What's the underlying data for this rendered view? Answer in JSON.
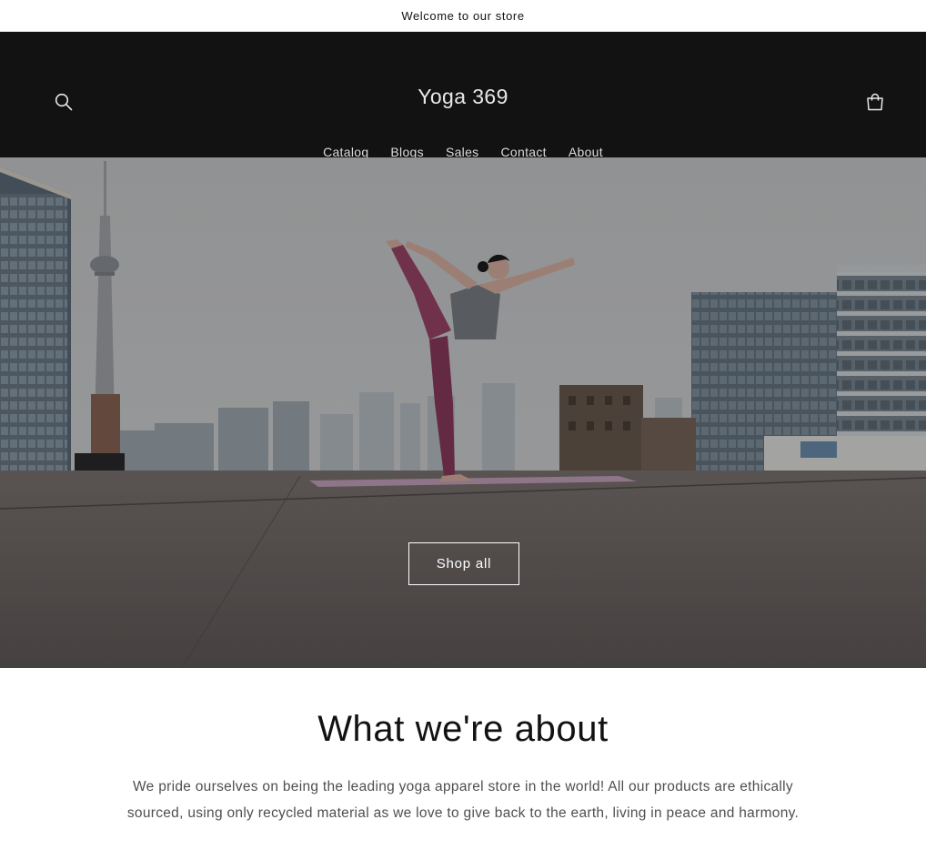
{
  "announcement": {
    "text": "Welcome to our store"
  },
  "header": {
    "logo": "Yoga 369",
    "search_icon": "search-icon",
    "cart_icon": "cart-icon",
    "nav": [
      {
        "label": "Catalog"
      },
      {
        "label": "Blogs"
      },
      {
        "label": "Sales"
      },
      {
        "label": "Contact"
      },
      {
        "label": "About"
      }
    ]
  },
  "hero": {
    "image": "yoga-pose-rooftop-city-skyline",
    "button_label": "Shop all"
  },
  "about": {
    "title": "What we're about",
    "body": "We pride ourselves on being the leading yoga apparel store in the world! All our products are ethically sourced, using only recycled material as we love to give back to the earth, living in peace and harmony."
  },
  "colors": {
    "header_bg": "#121212",
    "text": "#121212",
    "background": "#ffffff"
  }
}
